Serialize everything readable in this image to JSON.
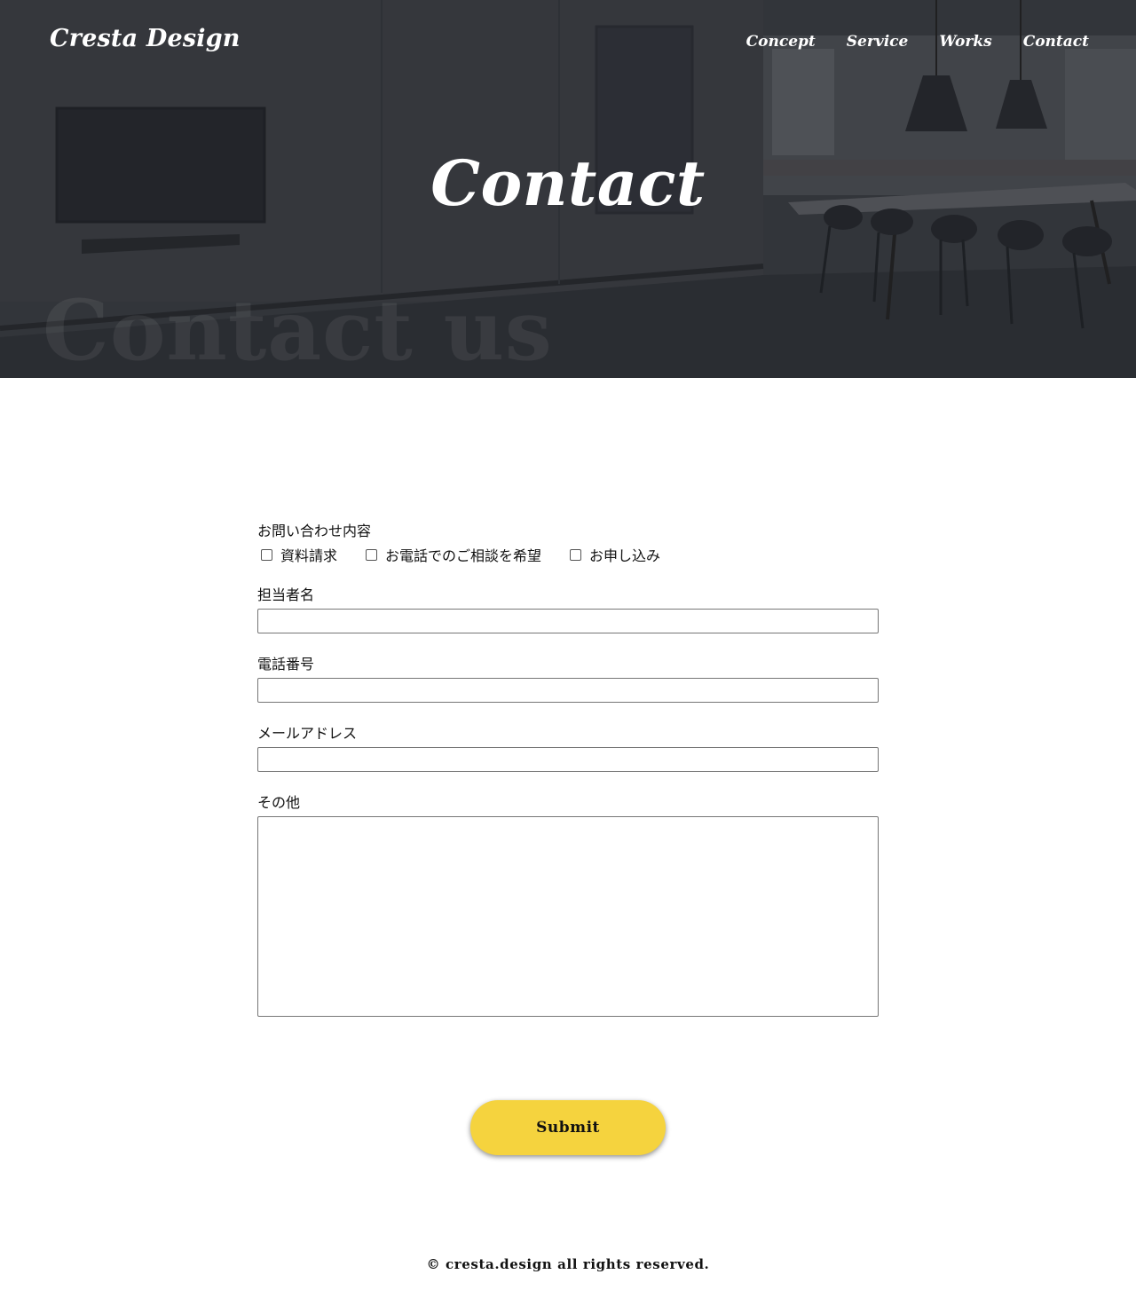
{
  "header": {
    "logo": "Cresta Design",
    "nav": [
      "Concept",
      "Service",
      "Works",
      "Contact"
    ]
  },
  "hero": {
    "title": "Contact",
    "watermark": "Contact us"
  },
  "form": {
    "inquiry_label": "お問い合わせ内容",
    "options": [
      "資料請求",
      "お電話でのご相談を希望",
      "お申し込み"
    ],
    "name_label": "担当者名",
    "name_value": "",
    "phone_label": "電話番号",
    "phone_value": "",
    "email_label": "メールアドレス",
    "email_value": "",
    "other_label": "その他",
    "other_value": "",
    "submit_label": "Submit"
  },
  "footer": {
    "copyright": "© cresta.design all rights reserved."
  },
  "colors": {
    "accent": "#f5d33e",
    "hero_dark": "#34383d"
  }
}
